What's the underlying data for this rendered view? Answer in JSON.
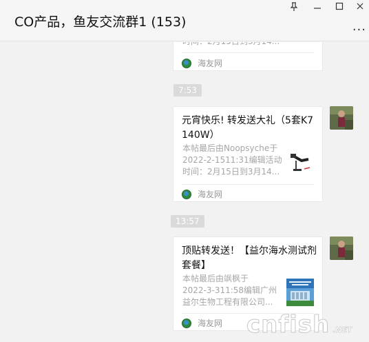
{
  "window": {
    "title": "CO产品，鱼友交流群1 (153)",
    "more_label": "...",
    "controls": {
      "pin": "pin-icon",
      "minimize": "minimize-icon",
      "maximize": "maximize-icon",
      "close": "close-icon"
    }
  },
  "messages": [
    {
      "type": "link_card",
      "desc_line_partial": "时间：2月15日到3月14...",
      "source": "海友网"
    },
    {
      "time": "7:53",
      "type": "link_card",
      "title": "元宵快乐! 转发送大礼（5套K7 140W）",
      "desc_lines": [
        "本帖最后由Noopsyche于",
        "2022-2-1511:31编辑活动",
        "时间：2月15日到3月14..."
      ],
      "source": "海友网"
    },
    {
      "time": "13:57",
      "type": "link_card",
      "title": "顶贴转发送！【益尔海水测试剂套餐】",
      "desc_lines": [
        "本帖最后由飒枫于",
        "2022-3-311:58编辑广州",
        "益尔生物工程有限公司..."
      ],
      "source": "海友网"
    }
  ],
  "watermark": {
    "text": "cnfish",
    "suffix": ".NET"
  },
  "colors": {
    "background": "#f2f2f2",
    "card": "#ffffff",
    "time_badge": "#dadada",
    "desc_text": "#a6a6a6"
  }
}
